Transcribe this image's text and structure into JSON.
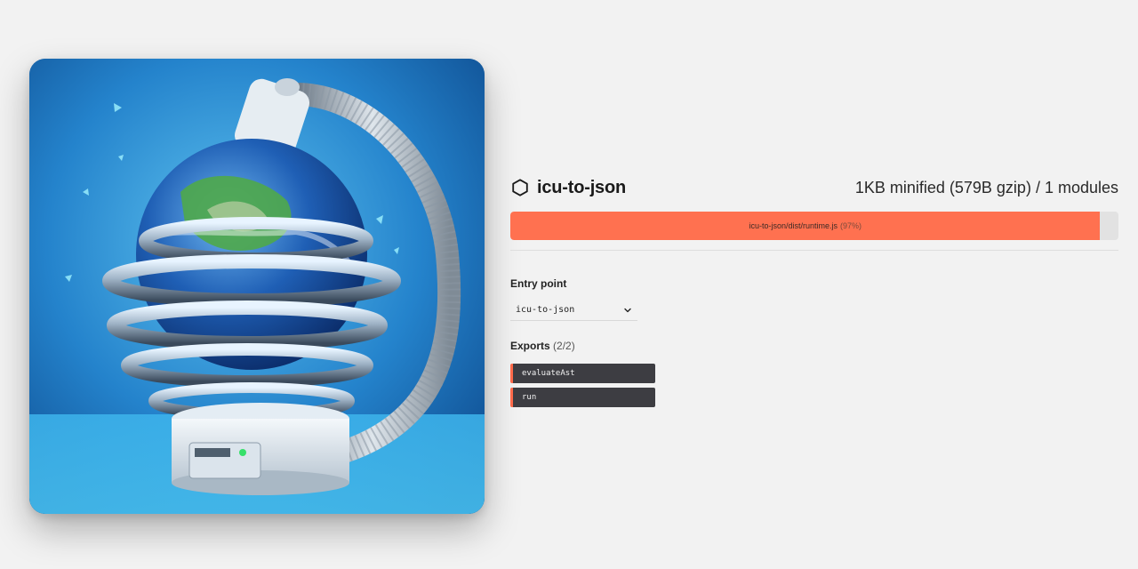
{
  "package": {
    "name": "icu-to-json",
    "icon": "package-hexagon-icon"
  },
  "summary": {
    "text": "1KB minified (579B gzip) / 1 modules"
  },
  "composition": {
    "label": "icu-to-json/dist/runtime.js",
    "percent_label": "(97%)",
    "fraction": 0.97,
    "fill_color": "#ff7150"
  },
  "entry_point": {
    "title": "Entry point",
    "selected": "icu-to-json"
  },
  "exports": {
    "title": "Exports",
    "count": "(2/2)",
    "items": [
      "evaluateAst",
      "run"
    ]
  },
  "hero": {
    "icon": "earth-vacuum-illustration"
  }
}
